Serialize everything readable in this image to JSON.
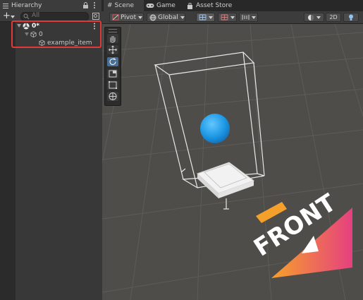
{
  "hierarchy": {
    "tab_label": "Hierarchy",
    "add_label": "+",
    "search_placeholder": "All",
    "tree": [
      {
        "label": "0*"
      },
      {
        "label": "0"
      },
      {
        "label": "example_item"
      }
    ]
  },
  "scene": {
    "tabs": [
      {
        "label": "Scene"
      },
      {
        "label": "Game"
      },
      {
        "label": "Asset Store"
      }
    ],
    "toolbar": {
      "pivot_label": "Pivot",
      "global_label": "Global",
      "mode_2d_label": "2D"
    },
    "gizmo_label": "FRONT"
  },
  "colors": {
    "selection_outline": "#e13a3a",
    "sphere": "#29a3e8",
    "active_tool": "#4a6f97",
    "front_arrow_start": "#f7a12a",
    "front_arrow_end": "#e5407f"
  }
}
